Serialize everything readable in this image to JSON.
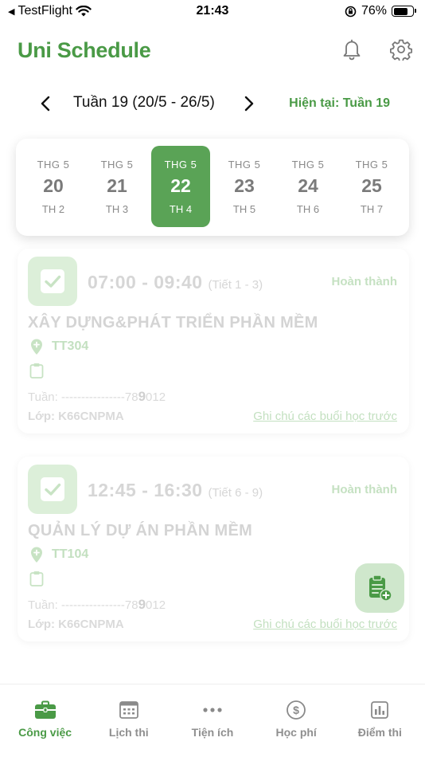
{
  "status_bar": {
    "carrier": "TestFlight",
    "time": "21:43",
    "battery": "76%",
    "battery_level": 0.76
  },
  "header": {
    "title": "Uni Schedule",
    "icons": [
      "bell-icon",
      "gear-icon"
    ]
  },
  "week_nav": {
    "label": "Tuần 19 (20/5 - 26/5)",
    "current": "Hiện tại: Tuần 19"
  },
  "days": [
    {
      "month": "THG 5",
      "date": "20",
      "weekday": "TH 2",
      "active": false
    },
    {
      "month": "THG 5",
      "date": "21",
      "weekday": "TH 3",
      "active": false
    },
    {
      "month": "THG 5",
      "date": "22",
      "weekday": "TH 4",
      "active": true
    },
    {
      "month": "THG 5",
      "date": "23",
      "weekday": "TH 5",
      "active": false
    },
    {
      "month": "THG 5",
      "date": "24",
      "weekday": "TH 6",
      "active": false
    },
    {
      "month": "THG 5",
      "date": "25",
      "weekday": "TH 7",
      "active": false
    }
  ],
  "classes": [
    {
      "time": "07:00 - 09:40",
      "period": "(Tiết 1 - 3)",
      "status": "Hoàn thành",
      "subject": "XÂY DỰNG&PHÁT TRIỂN PHẦN MỀM",
      "room": "TT304",
      "week_prefix": "Tuần: ----------------78",
      "week_highlight": "9",
      "week_suffix": "012",
      "class_code": "Lớp: K66CNPMA",
      "note_link": "Ghi chú các buổi học trước"
    },
    {
      "time": "12:45 - 16:30",
      "period": "(Tiết 6 - 9)",
      "status": "Hoàn thành",
      "subject": "QUẢN LÝ DỰ ÁN PHẦN MỀM",
      "room": "TT104",
      "week_prefix": "Tuần: ----------------78",
      "week_highlight": "9",
      "week_suffix": "012",
      "class_code": "Lớp: K66CNPMA",
      "note_link": "Ghi chú các buổi học trước"
    }
  ],
  "bottom_nav": [
    {
      "label": "Công việc",
      "icon": "briefcase-icon",
      "active": true
    },
    {
      "label": "Lịch thi",
      "icon": "calendar-icon",
      "active": false
    },
    {
      "label": "Tiện ích",
      "icon": "more-icon",
      "active": false
    },
    {
      "label": "Học phí",
      "icon": "dollar-icon",
      "active": false
    },
    {
      "label": "Điểm thi",
      "icon": "chart-icon",
      "active": false
    }
  ],
  "colors": {
    "accent": "#4a9a46",
    "active_day": "#5aa356",
    "faded_green": "#cfe7cc"
  }
}
